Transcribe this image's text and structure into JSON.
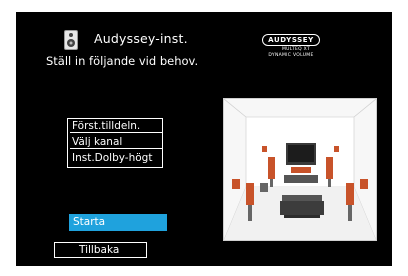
{
  "header": {
    "title": "Audyssey-inst.",
    "subtitle": "Ställ in följande vid behov.",
    "icon": "speaker-icon"
  },
  "logo": {
    "brand": "AUDYSSEY",
    "line1": "MULTEQ XT",
    "line2": "DYNAMIC VOLUME"
  },
  "menu": {
    "items": [
      {
        "label": "Först.tilldeln."
      },
      {
        "label": "Välj kanal"
      },
      {
        "label": "Inst.Dolby-högt"
      }
    ]
  },
  "buttons": {
    "start": "Starta",
    "back": "Tillbaka"
  },
  "colors": {
    "background": "#000000",
    "accent": "#1fa2dd",
    "speaker": "#c8532a",
    "text": "#ffffff"
  }
}
